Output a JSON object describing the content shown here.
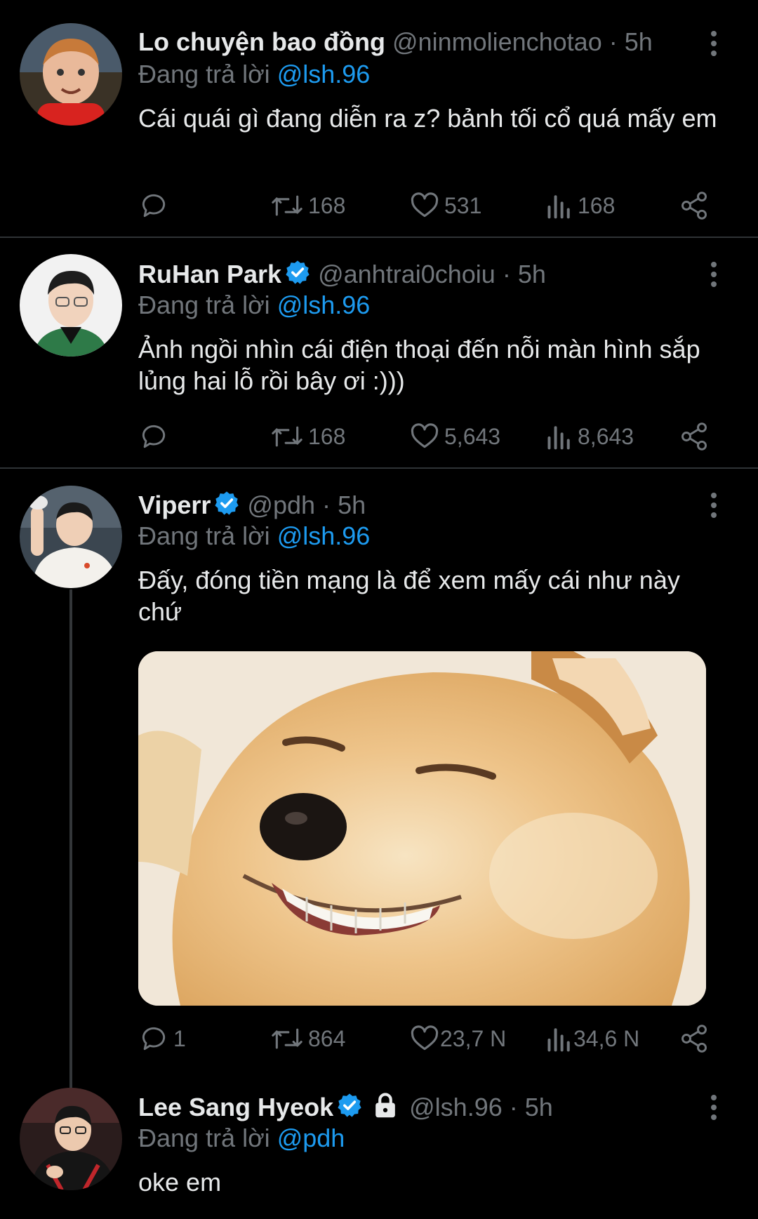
{
  "tweets": [
    {
      "name": "Lo chuyện bao đồng",
      "handle": "@ninmolienchotao",
      "time": "5h",
      "reply_prefix": "Đang trả lời",
      "reply_to": "@lsh.96",
      "text": "Cái quái gì đang diễn ra z? bảnh tối cổ quá mấy em",
      "replies": "",
      "retweets": "168",
      "likes": "531",
      "views": "168"
    },
    {
      "name": "RuHan Park",
      "handle": "@anhtrai0choiu",
      "time": "5h",
      "reply_prefix": "Đang trả lời",
      "reply_to": "@lsh.96",
      "text": "Ảnh ngồi nhìn cái điện thoại đến nỗi màn hình sắp lủng hai lỗ rồi bây ơi :)))",
      "replies": "",
      "retweets": "168",
      "likes": "5,643",
      "views": "8,643"
    },
    {
      "name": "Viperr",
      "handle": "@pdh",
      "time": "5h",
      "reply_prefix": "Đang trả lời",
      "reply_to": "@lsh.96",
      "text": "Đấy, đóng tiền mạng là để xem mấy cái như này chứ",
      "replies": "1",
      "retweets": "864",
      "likes": "23,7 N",
      "views": "34,6 N"
    },
    {
      "name": "Lee Sang Hyeok",
      "handle": "@lsh.96",
      "time": "5h",
      "reply_prefix": "Đang trả lời",
      "reply_to": "@pdh",
      "text": "oke em"
    }
  ],
  "separator": "·",
  "icons": {
    "reply": "reply-icon",
    "retweet": "retweet-icon",
    "like": "heart-icon",
    "views": "views-icon",
    "share": "share-icon",
    "more": "more-icon",
    "verified": "verified-badge-icon",
    "protected": "lock-icon"
  },
  "colors": {
    "background": "#000000",
    "text": "#e7e9ea",
    "muted": "#71767b",
    "link": "#1d9bf0",
    "divider": "#2f3336"
  }
}
